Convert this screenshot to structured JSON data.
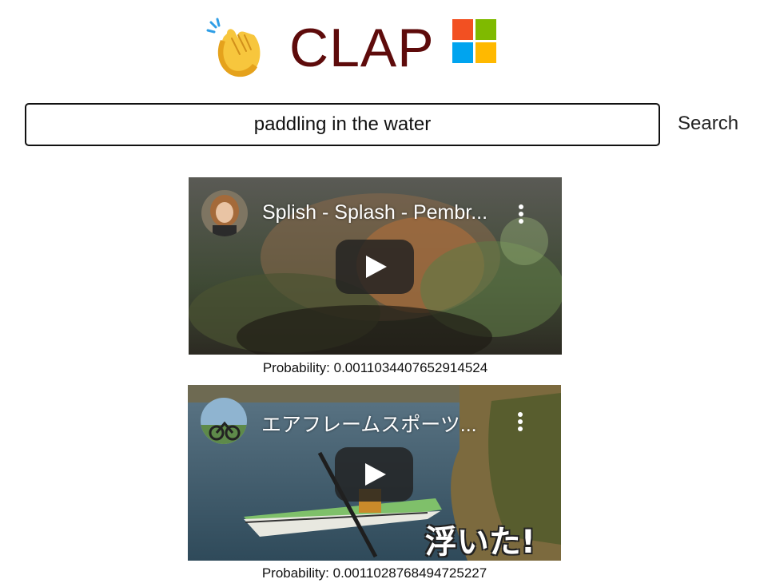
{
  "header": {
    "title": "CLAP",
    "clap_icon": "clapping-hands-icon",
    "logo_icon": "microsoft-logo-icon",
    "logo_colors": [
      "#f25022",
      "#7fba00",
      "#00a4ef",
      "#ffb900"
    ],
    "title_color": "#5e0b0b"
  },
  "search": {
    "value": "paddling in the water",
    "button_label": "Search"
  },
  "results": [
    {
      "video_title": "Splish - Splash - Pembr...",
      "probability_text": "Probability: 0.0011034407652914524",
      "thumbnail_icon": "corgi-in-water-thumbnail"
    },
    {
      "video_title": "エアフレームスポーツ...",
      "probability_text": "Probability: 0.0011028768494725227",
      "overlay_text": "浮いた!",
      "thumbnail_icon": "kayak-on-lake-thumbnail"
    }
  ]
}
